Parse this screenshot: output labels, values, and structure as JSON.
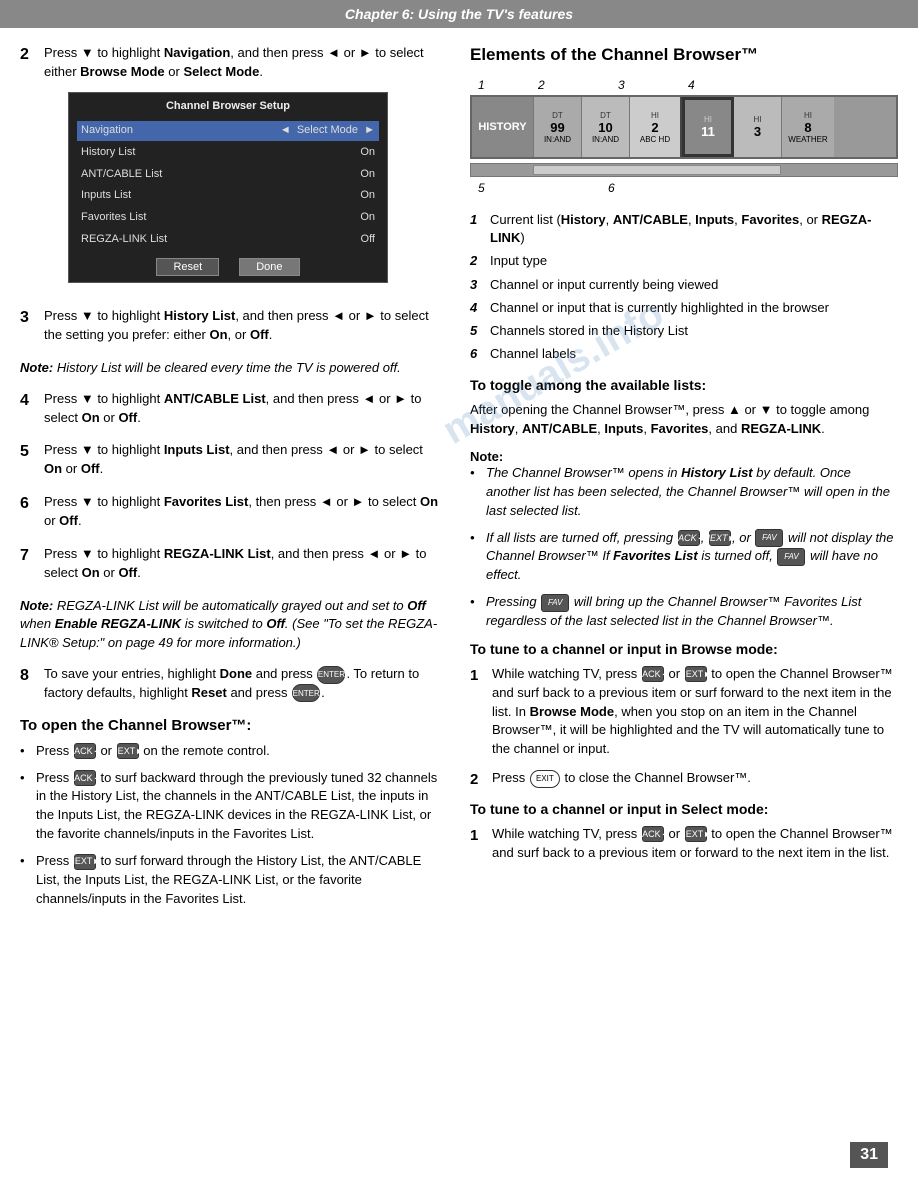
{
  "header": {
    "title": "Chapter 6: Using the TV's features"
  },
  "left": {
    "steps": [
      {
        "num": "2",
        "text_parts": [
          {
            "text": "Press ▼ to highlight ",
            "style": "normal"
          },
          {
            "text": "Navigation",
            "style": "bold"
          },
          {
            "text": ", and then press ◄ or ► to select either ",
            "style": "normal"
          },
          {
            "text": "Browse Mode",
            "style": "bold"
          },
          {
            "text": " or ",
            "style": "normal"
          },
          {
            "text": "Select Mode",
            "style": "bold"
          },
          {
            "text": ".",
            "style": "normal"
          }
        ]
      },
      {
        "num": "3",
        "text_parts": [
          {
            "text": "Press ▼ to highlight ",
            "style": "normal"
          },
          {
            "text": "History List",
            "style": "bold"
          },
          {
            "text": ", and then press ◄ or ► to select the setting you prefer: either ",
            "style": "normal"
          },
          {
            "text": "On",
            "style": "bold"
          },
          {
            "text": ", or ",
            "style": "normal"
          },
          {
            "text": "Off",
            "style": "bold"
          },
          {
            "text": ".",
            "style": "normal"
          }
        ]
      },
      {
        "num": "4",
        "text_parts": [
          {
            "text": "Press ▼ to highlight ",
            "style": "normal"
          },
          {
            "text": "ANT/CABLE List",
            "style": "bold"
          },
          {
            "text": ", and then press ◄ or ► to select ",
            "style": "normal"
          },
          {
            "text": "On",
            "style": "bold"
          },
          {
            "text": " or ",
            "style": "normal"
          },
          {
            "text": "Off",
            "style": "bold"
          },
          {
            "text": ".",
            "style": "normal"
          }
        ]
      },
      {
        "num": "5",
        "text_parts": [
          {
            "text": "Press ▼ to highlight ",
            "style": "normal"
          },
          {
            "text": "Inputs List",
            "style": "bold"
          },
          {
            "text": ", and then press ◄ or ► to select ",
            "style": "normal"
          },
          {
            "text": "On",
            "style": "bold"
          },
          {
            "text": " or ",
            "style": "normal"
          },
          {
            "text": "Off",
            "style": "bold"
          },
          {
            "text": ".",
            "style": "normal"
          }
        ]
      },
      {
        "num": "6",
        "text_parts": [
          {
            "text": "Press ▼ to highlight ",
            "style": "normal"
          },
          {
            "text": "Favorites List",
            "style": "bold"
          },
          {
            "text": ", then press ◄ or ► to select ",
            "style": "normal"
          },
          {
            "text": "On",
            "style": "bold"
          },
          {
            "text": " or ",
            "style": "normal"
          },
          {
            "text": "Off",
            "style": "bold"
          },
          {
            "text": ".",
            "style": "normal"
          }
        ]
      },
      {
        "num": "7",
        "text_parts": [
          {
            "text": "Press ▼ to highlight ",
            "style": "normal"
          },
          {
            "text": "REGZA-LINK List",
            "style": "bold"
          },
          {
            "text": ", and then press ◄ or ► to select ",
            "style": "normal"
          },
          {
            "text": "On",
            "style": "bold"
          },
          {
            "text": " or ",
            "style": "normal"
          },
          {
            "text": "Off",
            "style": "bold"
          },
          {
            "text": ".",
            "style": "normal"
          }
        ]
      },
      {
        "num": "8",
        "text_parts": [
          {
            "text": "To save your entries, highlight ",
            "style": "normal"
          },
          {
            "text": "Done",
            "style": "bold"
          },
          {
            "text": " and press ENTER. To return to factory defaults, highlight ",
            "style": "normal"
          },
          {
            "text": "Reset",
            "style": "bold"
          },
          {
            "text": " and press ENTER.",
            "style": "normal"
          }
        ]
      }
    ],
    "note1": {
      "label": "Note: ",
      "text": "History List will be cleared every time the TV is powered off."
    },
    "note2": {
      "label": "Note: ",
      "text": "REGZA-LINK List will be automatically grayed out and set to Off when Enable REGZA-LINK is switched to Off. (See \"To set the REGZA-LINK® Setup:\" on page 49 for more information.)"
    },
    "open_section_title": "To open the Channel Browser™:",
    "open_bullets": [
      "Press BACK◄ or NEXT► on the remote control.",
      "Press BACK◄ to surf backward through the previously tuned 32 channels in the History List, the channels in the ANT/CABLE List, the inputs in the Inputs List, the REGZA-LINK devices in the REGZA-LINK List, or the favorite channels/inputs in the Favorites List.",
      "Press NEXT► to surf forward through the History List, the ANT/CABLE List, the Inputs List, the REGZA-LINK List, or the favorite channels/inputs in the Favorites List."
    ],
    "cbs_title": "Channel Browser Setup",
    "cbs_rows": [
      {
        "label": "Navigation",
        "value": "◄  Select Mode  ►",
        "highlighted": true
      },
      {
        "label": "History List",
        "value": "On"
      },
      {
        "label": "ANT/CABLE List",
        "value": "On"
      },
      {
        "label": "Inputs List",
        "value": "On"
      },
      {
        "label": "Favorites List",
        "value": "On"
      },
      {
        "label": "REGZA-LINK List",
        "value": "Off"
      }
    ],
    "cbs_reset": "Reset",
    "cbs_done": "Done"
  },
  "right": {
    "section_title": "Elements of the Channel Browser™",
    "diagram_numbers_top": [
      "1",
      "2",
      "3",
      "4"
    ],
    "diagram_numbers_bottom": [
      "5",
      "6"
    ],
    "diagram_cells": [
      {
        "type": "history",
        "top": "",
        "main": "HISTORY",
        "sub": ""
      },
      {
        "type": "channel",
        "top": "DT",
        "main": "99",
        "sub": "IN:AND"
      },
      {
        "type": "channel",
        "top": "DT",
        "main": "10",
        "sub": "IN:AND"
      },
      {
        "type": "channel",
        "top": "HI",
        "main": "2",
        "sub": "ABC HD"
      },
      {
        "type": "channel-active",
        "top": "HI",
        "main": "11",
        "sub": ""
      },
      {
        "type": "channel",
        "top": "HI",
        "main": "3",
        "sub": ""
      },
      {
        "type": "channel",
        "top": "HI",
        "main": "8",
        "sub": "WEATHER"
      }
    ],
    "legend": [
      {
        "num": "1",
        "text": "Current list (History, ANT/CABLE, Inputs, Favorites, or REGZA-LINK)"
      },
      {
        "num": "2",
        "text": "Input type"
      },
      {
        "num": "3",
        "text": "Channel or input currently being viewed"
      },
      {
        "num": "4",
        "text": "Channel or input that is currently highlighted in the browser"
      },
      {
        "num": "5",
        "text": "Channels stored in the History List"
      },
      {
        "num": "6",
        "text": "Channel labels"
      }
    ],
    "toggle_title": "To toggle among the available lists:",
    "toggle_text": "After opening the Channel Browser™, press ▲ or ▼ to toggle among History, ANT/CABLE, Inputs, Favorites, and REGZA-LINK.",
    "note_label": "Note:",
    "note_bullets": [
      "The Channel Browser™ opens in History List by default. Once another list has been selected, the Channel Browser™ will open in the last selected list.",
      "If all lists are turned off, pressing BACK◄, NEXT►, or FAV will not display the Channel Browser™ If Favorites List is turned off, FAV will have no effect.",
      "Pressing FAV will bring up the Channel Browser™ Favorites List regardless of the last selected list in the Channel Browser™."
    ],
    "browse_mode_title": "To tune to a channel or input in Browse mode:",
    "browse_mode_steps": [
      {
        "num": "1",
        "text": "While watching TV, press BACK◄ or NEXT► to open the Channel Browser™ and surf back to a previous item or surf forward to the next item in the list. In Browse Mode, when you stop on an item in the Channel Browser™, it will be highlighted and the TV will automatically tune to the channel or input."
      },
      {
        "num": "2",
        "text": "Press EXIT to close the Channel Browser™."
      }
    ],
    "select_mode_title": "To tune to a channel or input in Select mode:",
    "select_mode_steps": [
      {
        "num": "1",
        "text": "While watching TV, press BACK◄ or NEXT► to open the Channel Browser™ and surf back to a previous item or forward to the next item in the list."
      }
    ]
  },
  "page_number": "31",
  "watermark": "manuals.info"
}
